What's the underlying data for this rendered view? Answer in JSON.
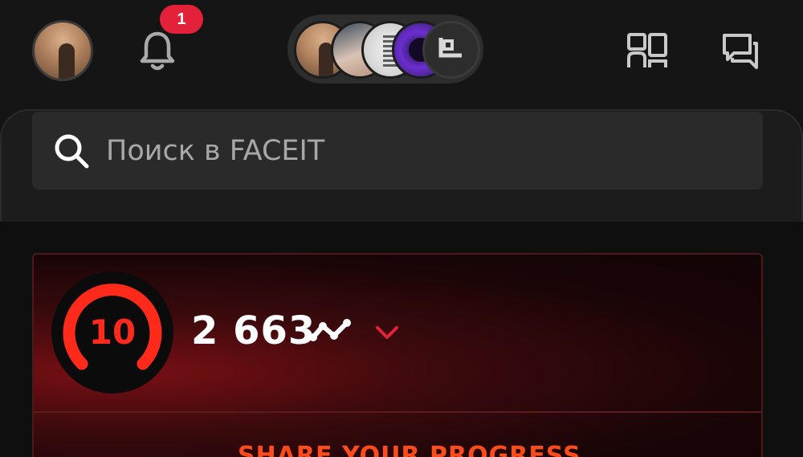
{
  "header": {
    "notification_count": "1",
    "icons": [
      "bell-icon",
      "friends-icon",
      "chat-icon"
    ]
  },
  "clubs": {
    "count": 5
  },
  "search": {
    "placeholder": "Поиск в FACEIT"
  },
  "level_card": {
    "level": "10",
    "elo": "2 663",
    "share_label": "SHARE YOUR PROGRESS",
    "accent": "#ff2a1a"
  }
}
